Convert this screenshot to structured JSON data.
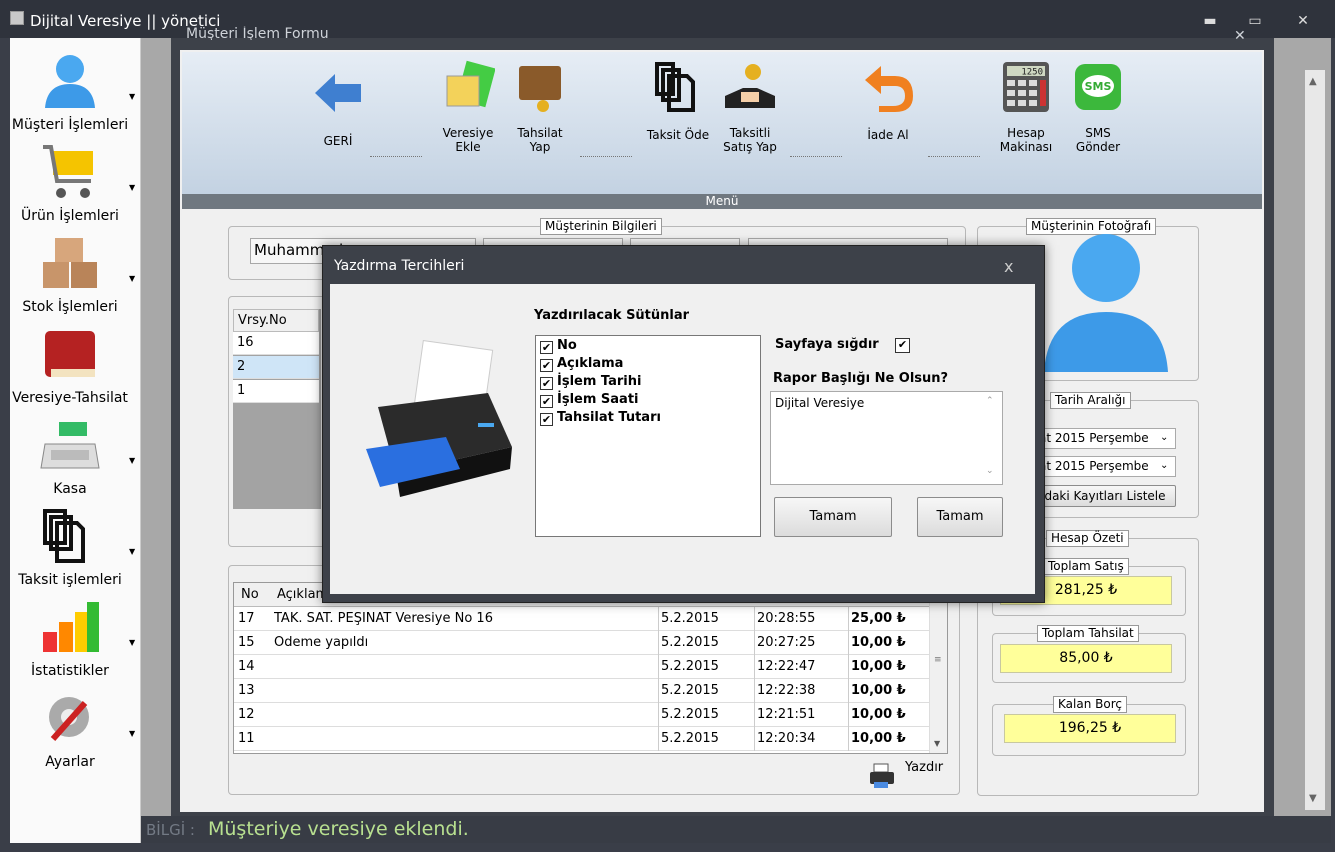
{
  "window": {
    "title": "Dijital Veresiye  ||  yönetici",
    "min": "▬",
    "max": "▭",
    "close": "✕"
  },
  "sidebar": {
    "items": [
      {
        "label": "Müşteri İşlemleri",
        "icon": "user-icon"
      },
      {
        "label": "Ürün İşlemleri",
        "icon": "cart-icon"
      },
      {
        "label": "Stok İşlemleri",
        "icon": "boxes-icon"
      },
      {
        "label": "Veresiye-Tahsilat",
        "icon": "book-icon"
      },
      {
        "label": "Kasa",
        "icon": "cash-register-icon"
      },
      {
        "label": "Taksit işlemleri",
        "icon": "documents-icon"
      },
      {
        "label": "İstatistikler",
        "icon": "bar-chart-icon"
      },
      {
        "label": "Ayarlar",
        "icon": "settings-icon"
      }
    ]
  },
  "form": {
    "title": "Müşteri İşlem Formu",
    "close": "✕",
    "toolbar": {
      "back": "GERİ",
      "add_credit": [
        "Veresiye",
        "Ekle"
      ],
      "collect": [
        "Tahsilat",
        "Yap"
      ],
      "pay_installment": "Taksit Öde",
      "installment_sale": [
        "Taksitli",
        "Satış Yap"
      ],
      "return": "İade Al",
      "calculator": [
        "Hesap",
        "Makinası"
      ],
      "sms": [
        "SMS",
        "Gönder"
      ],
      "calc_display": "1250",
      "sms_text": "SMS"
    },
    "menu_label": "Menü",
    "customer_info": {
      "title": "Müşterinin Bilgileri",
      "name": "Muhammed"
    },
    "photo_title": "Müşterinin Fotoğrafı",
    "date_range": {
      "title": "Tarih Aralığı",
      "from": "at  2015 Perşembe",
      "to": "at  2015 Perşembe",
      "button": "daki Kayıtları Listele"
    },
    "credit_list": {
      "header": "Vrsy.No",
      "rows": [
        "16",
        "2",
        "1"
      ]
    },
    "transactions": {
      "headers": [
        "No",
        "Açıklama"
      ],
      "rows": [
        {
          "no": "17",
          "desc": "TAK. SAT. PEŞİNAT Veresiye No 16",
          "date": "5.2.2015",
          "time": "20:28:55",
          "amount": "25,00 ₺"
        },
        {
          "no": "15",
          "desc": "Ödeme yapıldı",
          "date": "5.2.2015",
          "time": "20:27:25",
          "amount": "10,00 ₺"
        },
        {
          "no": "14",
          "desc": "",
          "date": "5.2.2015",
          "time": "12:22:47",
          "amount": "10,00 ₺"
        },
        {
          "no": "13",
          "desc": "",
          "date": "5.2.2015",
          "time": "12:22:38",
          "amount": "10,00 ₺"
        },
        {
          "no": "12",
          "desc": "",
          "date": "5.2.2015",
          "time": "12:21:51",
          "amount": "10,00 ₺"
        },
        {
          "no": "11",
          "desc": "",
          "date": "5.2.2015",
          "time": "12:20:34",
          "amount": "10,00 ₺"
        }
      ]
    },
    "print_label": "Yazdır",
    "summary": {
      "title": "Hesap Özeti",
      "total_sales_label": "Toplam Satış",
      "total_sales": "281,25 ₺",
      "total_collected_label": "Toplam Tahsilat",
      "total_collected": "85,00 ₺",
      "remaining_label": "Kalan Borç",
      "remaining": "196,25 ₺"
    }
  },
  "dialog": {
    "title": "Yazdırma Tercihleri",
    "close": "x",
    "columns_label": "Yazdırılacak Sütünlar",
    "columns": [
      "No",
      "Açıklama",
      "İşlem Tarihi",
      "İşlem Saati",
      "Tahsilat Tutarı"
    ],
    "check": "✔",
    "fit_label": "Sayfaya sığdır",
    "report_title_label": "Rapor Başlığı Ne Olsun?",
    "report_title_value": "Dijital Veresiye",
    "ok1": "Tamam",
    "ok2": "Tamam"
  },
  "status": {
    "prefix": "BİLGİ :",
    "message": "Müşteriye veresiye eklendi."
  }
}
